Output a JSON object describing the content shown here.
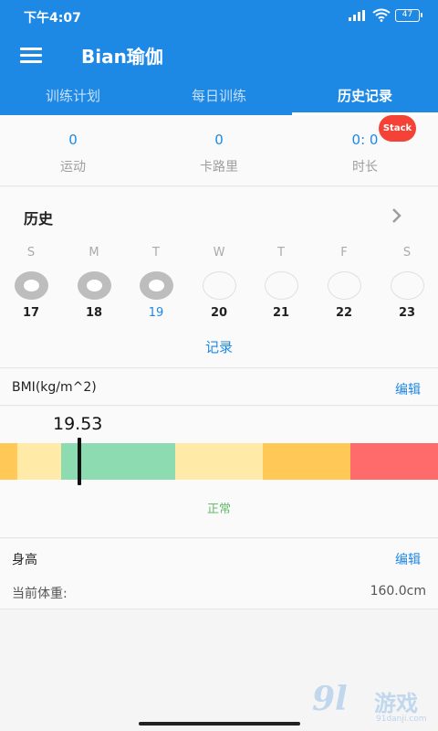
{
  "status_bar": {
    "time": "下午4:07",
    "battery": "47"
  },
  "app_bar": {
    "title": "Bian瑜伽"
  },
  "tabs": [
    {
      "label": "训练计划",
      "active": false
    },
    {
      "label": "每日训练",
      "active": false
    },
    {
      "label": "历史记录",
      "active": true
    }
  ],
  "stats": [
    {
      "value": "0",
      "label": "运动"
    },
    {
      "value": "0",
      "label": "卡路里"
    },
    {
      "value": "0: 0",
      "label": "时长"
    }
  ],
  "stack_badge": "Stack",
  "history": {
    "title": "历史",
    "week": [
      {
        "letter": "S",
        "day": "17",
        "done": true
      },
      {
        "letter": "M",
        "day": "18",
        "done": true
      },
      {
        "letter": "T",
        "day": "19",
        "done": true,
        "today": true
      },
      {
        "letter": "W",
        "day": "20",
        "done": false
      },
      {
        "letter": "T",
        "day": "21",
        "done": false
      },
      {
        "letter": "F",
        "day": "22",
        "done": false
      },
      {
        "letter": "S",
        "day": "23",
        "done": false
      }
    ],
    "record_link": "记录"
  },
  "bmi": {
    "title": "BMI(kg/m^2)",
    "edit_label": "编辑",
    "value": "19.53",
    "status": "正常",
    "colors": [
      "#ffc857",
      "#ffeaa7",
      "#8ddbb0",
      "#ffeaa7",
      "#ffc857",
      "#ff6b6b"
    ]
  },
  "height": {
    "title": "身高",
    "edit_label": "编辑",
    "current_label": "当前体重:",
    "current_value": "160.0cm"
  },
  "watermark": {
    "big": "9l",
    "cn": "游戏",
    "url": "91danji.com"
  }
}
